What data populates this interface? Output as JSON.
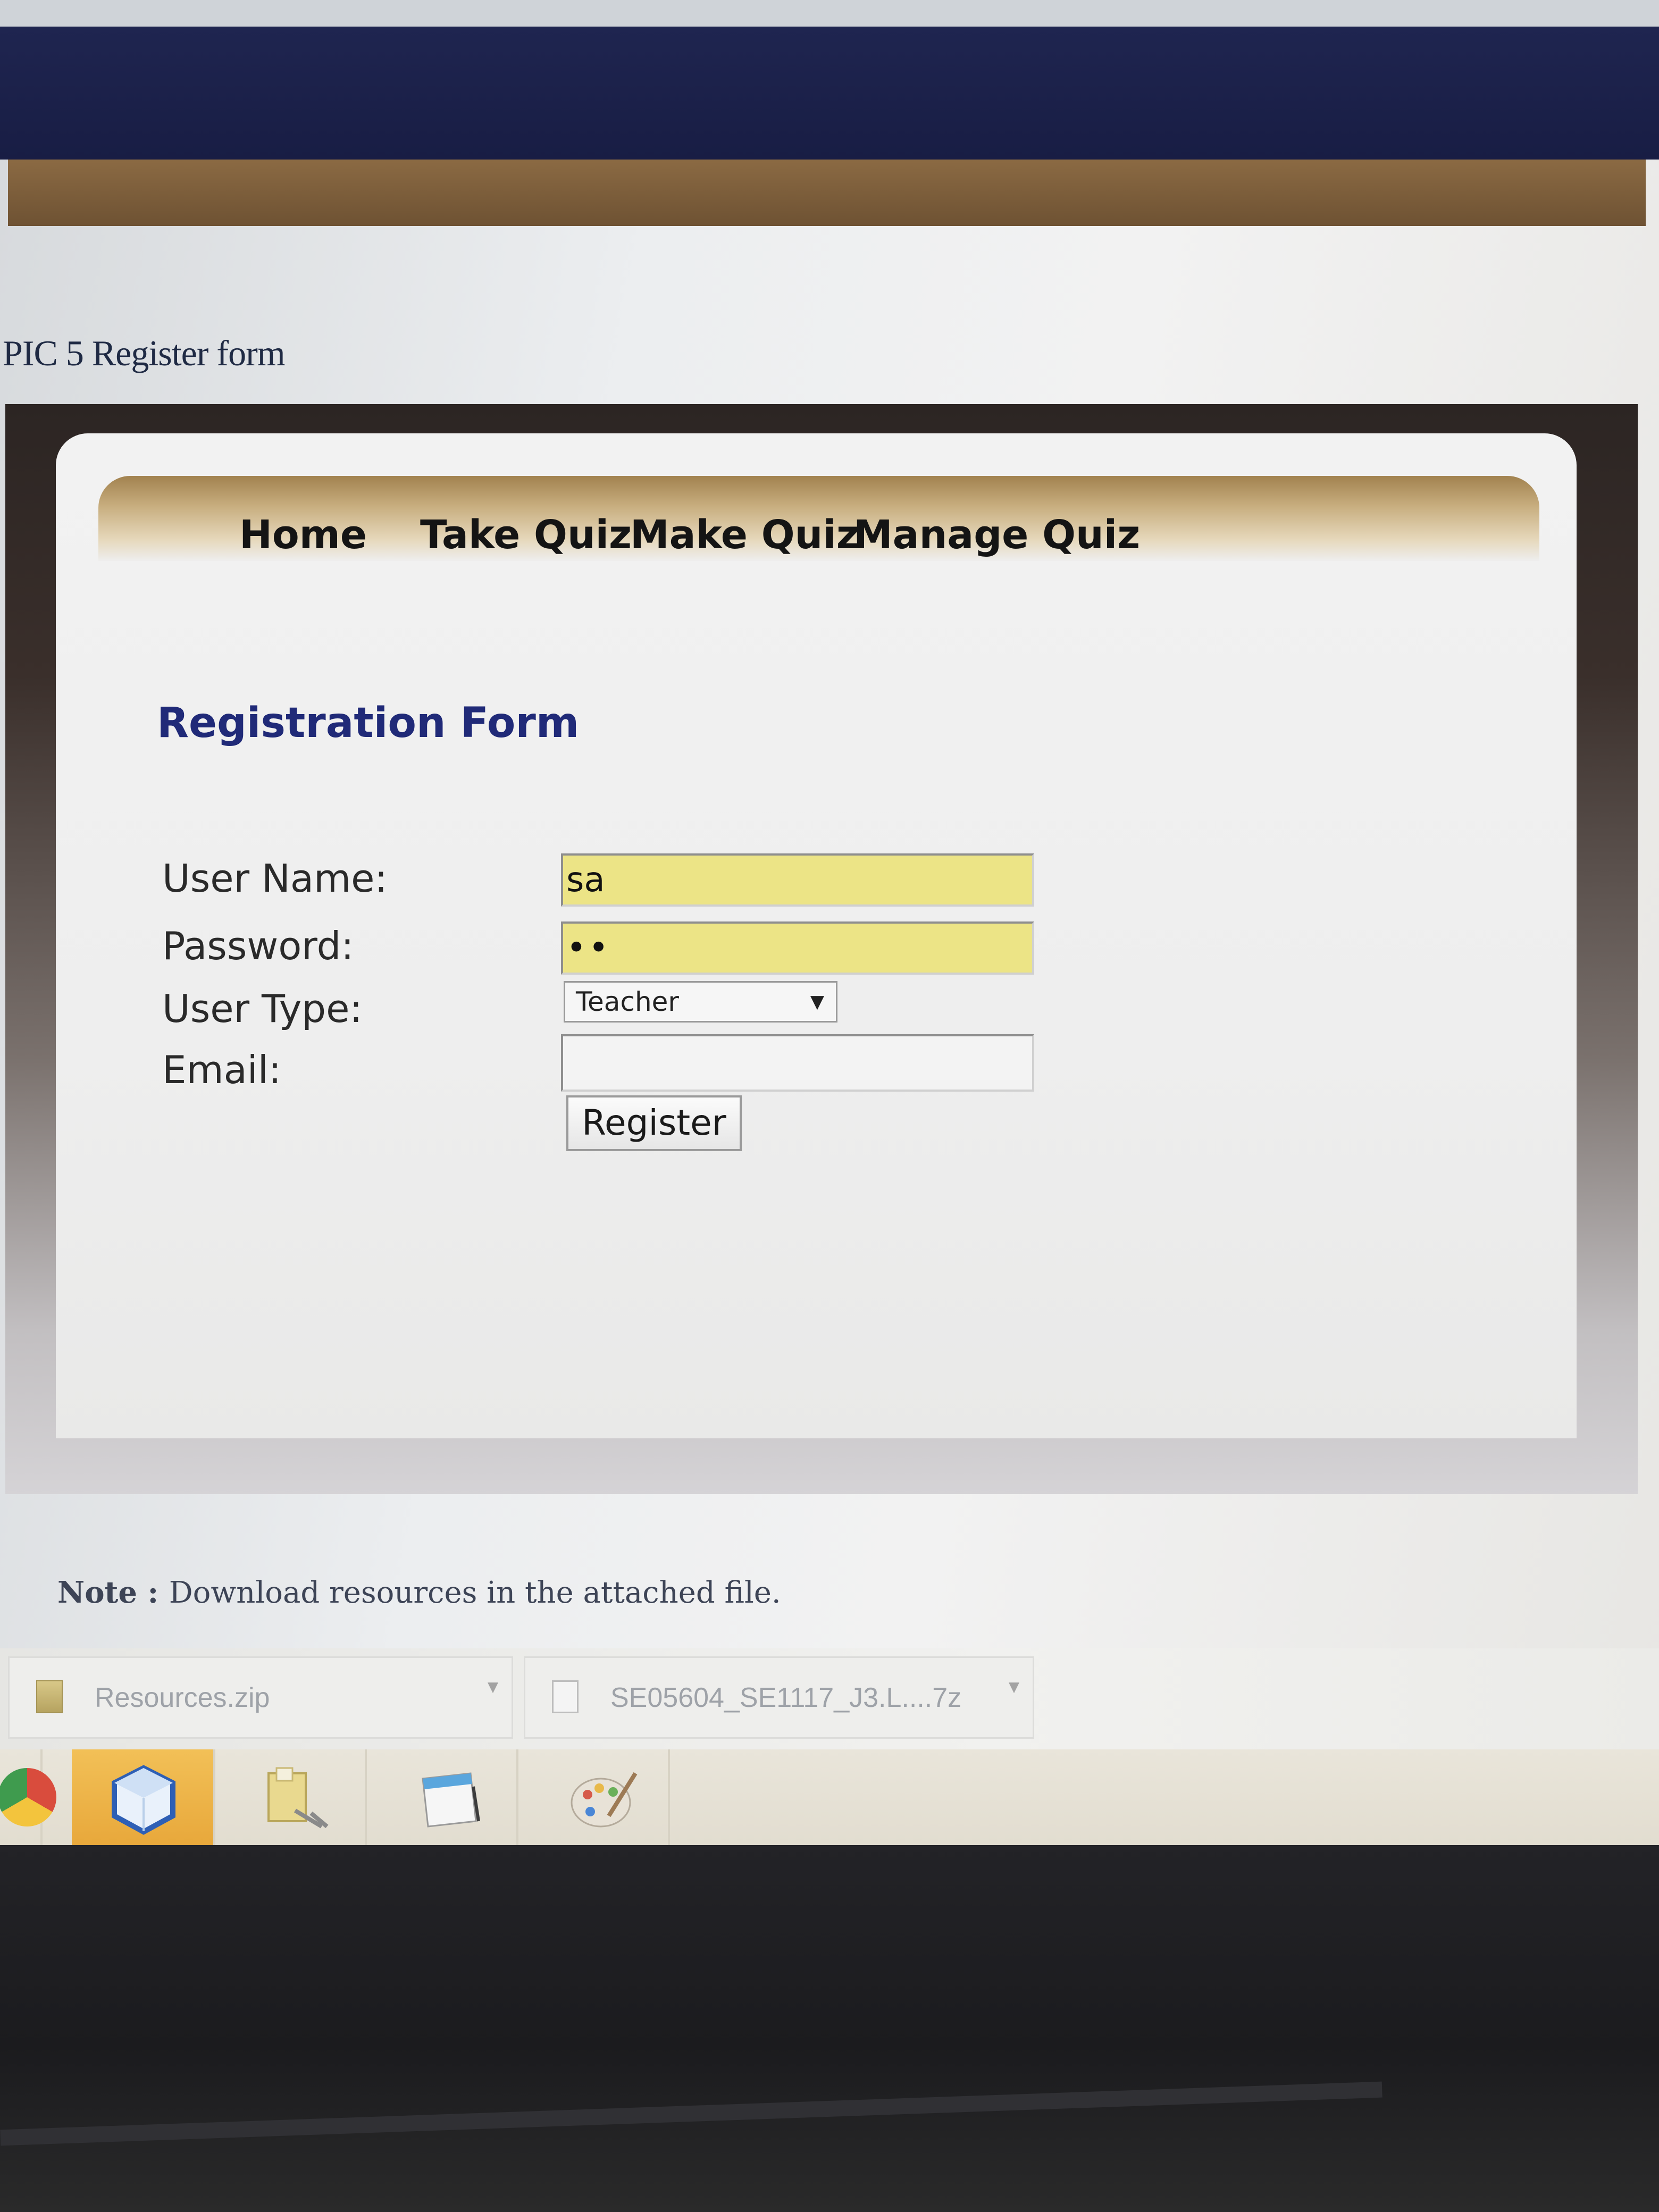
{
  "document": {
    "caption": "PIC 5 Register form",
    "note_prefix": "Note : ",
    "note_text": "Download resources in the attached file."
  },
  "nav": {
    "items": [
      {
        "label": "Home"
      },
      {
        "label": "Take Quiz"
      },
      {
        "label": "Make Quiz"
      },
      {
        "label": "Manage Quiz"
      }
    ]
  },
  "form": {
    "title": "Registration Form",
    "username_label": "User Name:",
    "username_value": "sa",
    "password_label": "Password:",
    "password_value": "••",
    "usertype_label": "User Type:",
    "usertype_value": "Teacher",
    "email_label": "Email:",
    "email_value": "",
    "register_label": "Register"
  },
  "downloads": [
    {
      "name": "Resources.zip",
      "icon": "zip-icon"
    },
    {
      "name": "SE05604_SE1117_J3.L....7z",
      "icon": "file-icon"
    }
  ],
  "taskbar": {
    "apps": [
      "chrome-icon",
      "cube-icon",
      "explorer-icon",
      "notepad-icon",
      "paint-icon"
    ]
  },
  "colors": {
    "banner_blue": "#1f2550",
    "banner_brown": "#8b6a43",
    "form_title": "#202a78",
    "input_highlight": "#ece486",
    "taskbar_active": "#e8a83b"
  }
}
